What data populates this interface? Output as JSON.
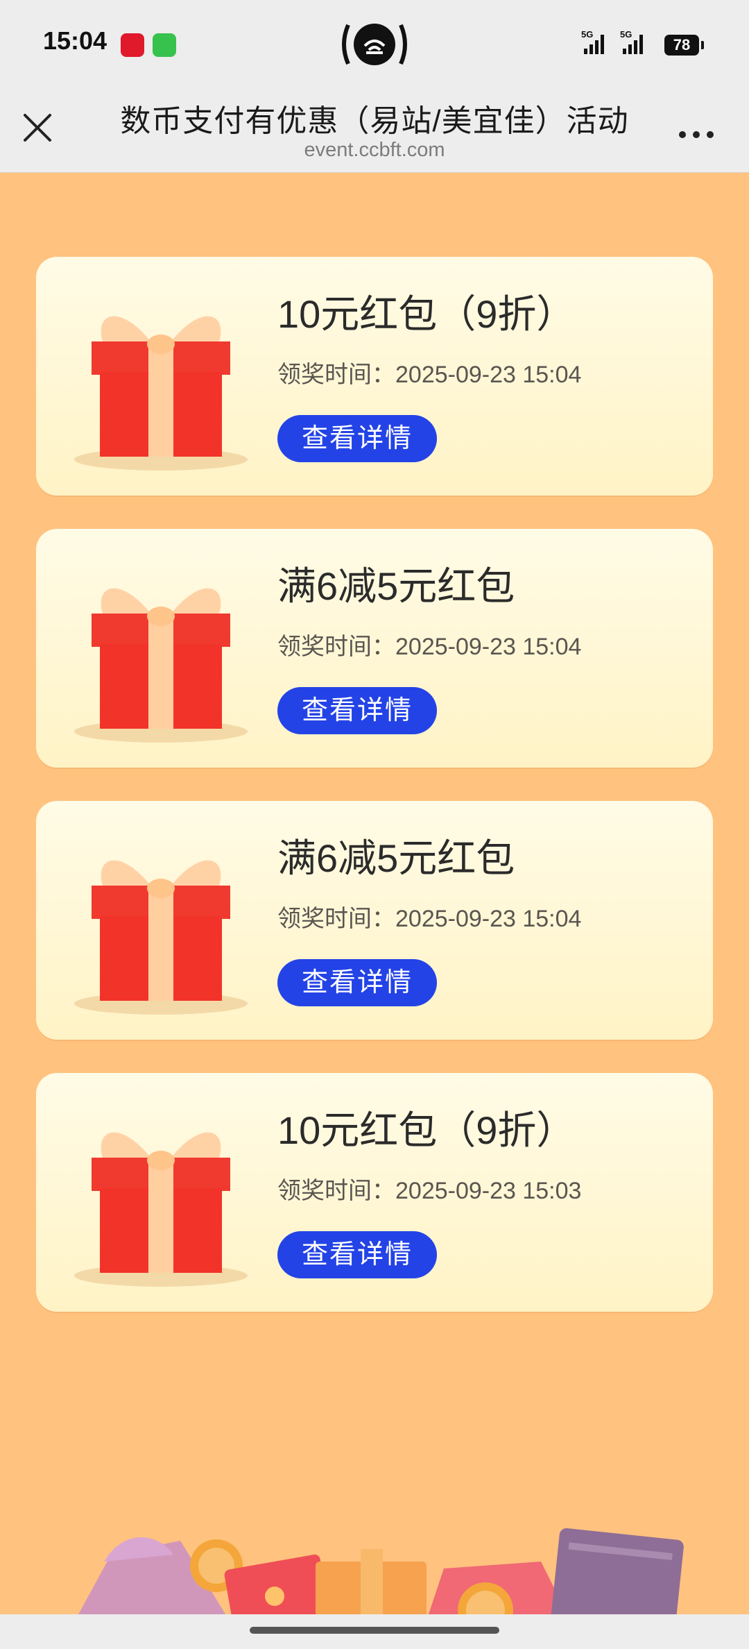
{
  "status_bar": {
    "time": "15:04",
    "network_1": "5G",
    "network_2": "5G",
    "battery": "78"
  },
  "header": {
    "title": "数币支付有优惠（易站/美宜佳）活动",
    "domain": "event.ccbft.com",
    "close_icon": "close-icon",
    "more_icon": "more-icon"
  },
  "rewards": [
    {
      "title": "10元红包（9折）",
      "time": "领奖时间：2025-09-23 15:04",
      "button": "查看详情"
    },
    {
      "title": "满6减5元红包",
      "time": "领奖时间：2025-09-23 15:04",
      "button": "查看详情"
    },
    {
      "title": "满6减5元红包",
      "time": "领奖时间：2025-09-23 15:04",
      "button": "查看详情"
    },
    {
      "title": "10元红包（9折）",
      "time": "领奖时间：2025-09-23 15:03",
      "button": "查看详情"
    }
  ],
  "colors": {
    "page_bg": "#FFC27F",
    "card_bg": "#FFF7D8",
    "button": "#2443E6",
    "gift_red": "#F2332A",
    "ribbon": "#FFCFA0"
  }
}
